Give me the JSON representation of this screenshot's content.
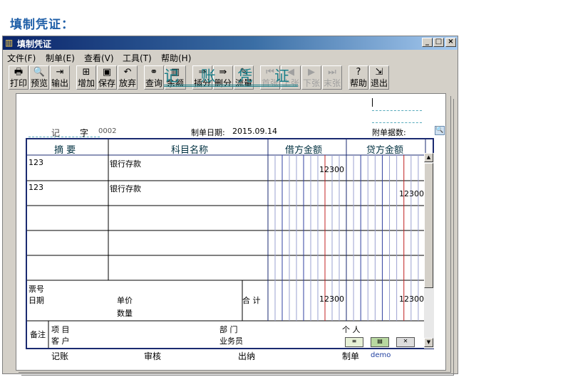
{
  "page_heading": "填制凭证：",
  "window": {
    "title": "填制凭证"
  },
  "menu": [
    "文件(F)",
    "制单(E)",
    "查看(V)",
    "工具(T)",
    "帮助(H)"
  ],
  "toolbar": [
    {
      "label": "打印",
      "icon": "printer-icon",
      "glyph": "🖶"
    },
    {
      "label": "预览",
      "icon": "preview-icon",
      "glyph": "🔍"
    },
    {
      "label": "输出",
      "icon": "export-icon",
      "glyph": "⇥"
    },
    {
      "label": "增加",
      "icon": "add-icon",
      "glyph": "⊞"
    },
    {
      "label": "保存",
      "icon": "save-icon",
      "glyph": "▣"
    },
    {
      "label": "放弃",
      "icon": "undo-icon",
      "glyph": "↶"
    },
    {
      "label": "查询",
      "icon": "binoculars-icon",
      "glyph": "⚭"
    },
    {
      "label": "余额",
      "icon": "bar-chart-icon",
      "glyph": "▥"
    },
    {
      "label": "插分",
      "icon": "insert-row-icon",
      "glyph": "⇒"
    },
    {
      "label": "删分",
      "icon": "delete-row-icon",
      "glyph": "⇛"
    },
    {
      "label": "流量",
      "icon": "cash-flow-icon",
      "glyph": "✎"
    },
    {
      "label": "首张",
      "icon": "first-icon",
      "glyph": "⏮",
      "disabled": true
    },
    {
      "label": "上张",
      "icon": "prev-icon",
      "glyph": "◀",
      "disabled": true
    },
    {
      "label": "下张",
      "icon": "next-icon",
      "glyph": "▶",
      "disabled": true
    },
    {
      "label": "末张",
      "icon": "last-icon",
      "glyph": "⏭",
      "disabled": true
    },
    {
      "label": "帮助",
      "icon": "help-icon",
      "glyph": "?"
    },
    {
      "label": "退出",
      "icon": "exit-icon",
      "glyph": "⇲"
    }
  ],
  "voucher": {
    "title": "记 账 凭 证",
    "type": "记",
    "zi": "字",
    "number": "0002",
    "date_label": "制单日期:",
    "date": "2015.09.14",
    "attach_label": "附单据数:",
    "col_summary": "摘 要",
    "col_account": "科目名称",
    "col_debit": "借方金额",
    "col_credit": "贷方金额",
    "rows": [
      {
        "summary": "123",
        "account": "银行存款",
        "debit": "12300",
        "credit": ""
      },
      {
        "summary": "123",
        "account": "银行存款",
        "debit": "",
        "credit": "12300"
      },
      {
        "summary": "",
        "account": "",
        "debit": "",
        "credit": ""
      },
      {
        "summary": "",
        "account": "",
        "debit": "",
        "credit": ""
      },
      {
        "summary": "",
        "account": "",
        "debit": "",
        "credit": ""
      }
    ],
    "ticket_label": "票号",
    "date2_label": "日期",
    "price_label": "单价",
    "qty_label": "数量",
    "total_label": "合 计",
    "total_debit": "12300",
    "total_credit": "12300",
    "remark_label": "备注",
    "project_label": "项  目",
    "customer_label": "客  户",
    "dept_label": "部  门",
    "person_label": "个  人",
    "sales_label": "业务员",
    "footer": {
      "bookkeep": "记账",
      "audit": "审核",
      "cashier": "出纳",
      "maker_label": "制单",
      "maker": "demo"
    }
  }
}
